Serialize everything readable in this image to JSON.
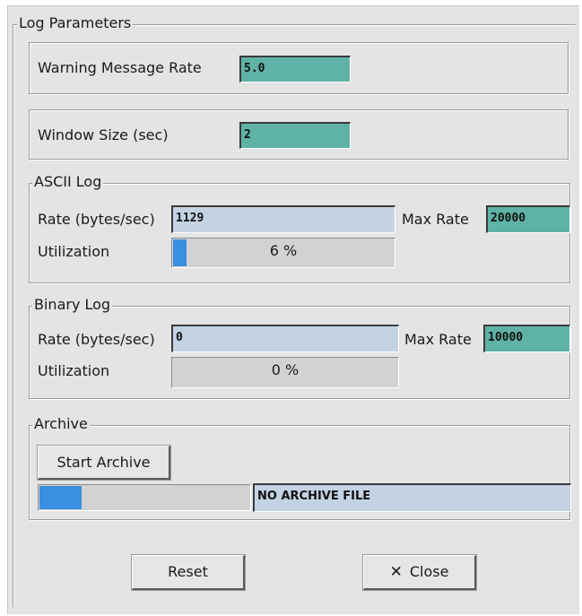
{
  "log_parameters": {
    "title": "Log Parameters",
    "warning_rate": {
      "label": "Warning Message Rate",
      "value": "5.0"
    },
    "window_size": {
      "label": "Window Size (sec)",
      "value": "2"
    }
  },
  "ascii_log": {
    "title": "ASCII Log",
    "rate_label": "Rate (bytes/sec)",
    "rate_value": "1129",
    "max_rate_label": "Max Rate",
    "max_rate_value": "20000",
    "utilization_label": "Utilization",
    "utilization_text": "6 %",
    "utilization_fraction": 0.06
  },
  "binary_log": {
    "title": "Binary Log",
    "rate_label": "Rate (bytes/sec)",
    "rate_value": "0",
    "max_rate_label": "Max Rate",
    "max_rate_value": "10000",
    "utilization_label": "Utilization",
    "utilization_text": "0 %",
    "utilization_fraction": 0.0
  },
  "archive": {
    "title": "Archive",
    "start_button": "Start Archive",
    "progress_fraction": 0.2,
    "file_status": "NO ARCHIVE FILE"
  },
  "footer": {
    "reset_button": "Reset",
    "close_button": "Close",
    "close_icon": "x-icon"
  },
  "colors": {
    "panel": "#e4e4e4",
    "teal_field": "#5fb2a6",
    "blue_field": "#c3d3e3",
    "progress_fill": "#3a8fe0"
  }
}
